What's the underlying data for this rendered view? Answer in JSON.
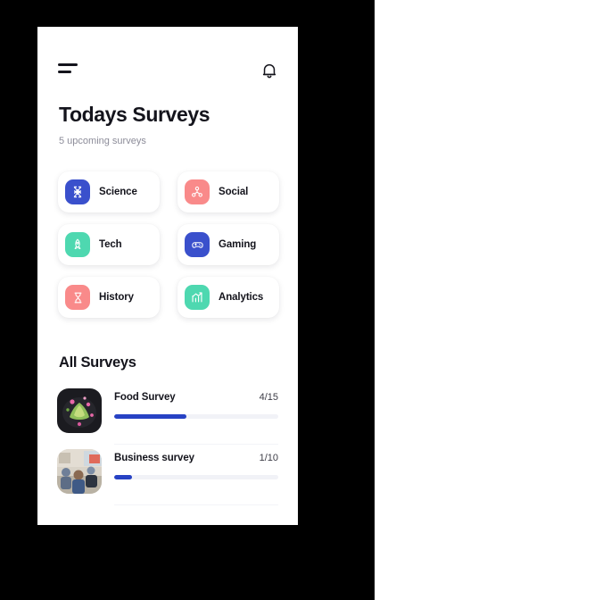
{
  "theme": {
    "page_background": "#ffffff",
    "backdrop": "#000000",
    "screen_background": "#ffffff",
    "text_primary": "#14141c",
    "text_muted": "#8c8c99",
    "accent_blue": "#2742c4",
    "accent_indigo": "#3a50cc",
    "accent_salmon": "#f98a8a",
    "accent_mint": "#4ed8b0",
    "progress_track": "#f1f2f7"
  },
  "header": {
    "menu_icon": "hamburger-menu-icon",
    "bell_icon": "notification-bell-icon",
    "title": "Todays Surveys",
    "subtitle": "5 upcoming surveys"
  },
  "categories": [
    {
      "label": "Science",
      "icon": "dna-icon",
      "icon_bg": "#3a50cc"
    },
    {
      "label": "Social",
      "icon": "network-icon",
      "icon_bg": "#f98a8a"
    },
    {
      "label": "Tech",
      "icon": "rocket-icon",
      "icon_bg": "#4ed8b0"
    },
    {
      "label": "Gaming",
      "icon": "gamepad-icon",
      "icon_bg": "#3a50cc"
    },
    {
      "label": "History",
      "icon": "hourglass-icon",
      "icon_bg": "#f98a8a"
    },
    {
      "label": "Analytics",
      "icon": "bar-chart-icon",
      "icon_bg": "#4ed8b0"
    }
  ],
  "all_surveys": {
    "section_title": "All Surveys",
    "items": [
      {
        "name": "Food Survey",
        "count": "4/15",
        "progress_percent": 44,
        "thumbnail": "food-photo-thumbnail"
      },
      {
        "name": "Business survey",
        "count": "1/10",
        "progress_percent": 11,
        "thumbnail": "business-meeting-photo-thumbnail"
      }
    ]
  }
}
